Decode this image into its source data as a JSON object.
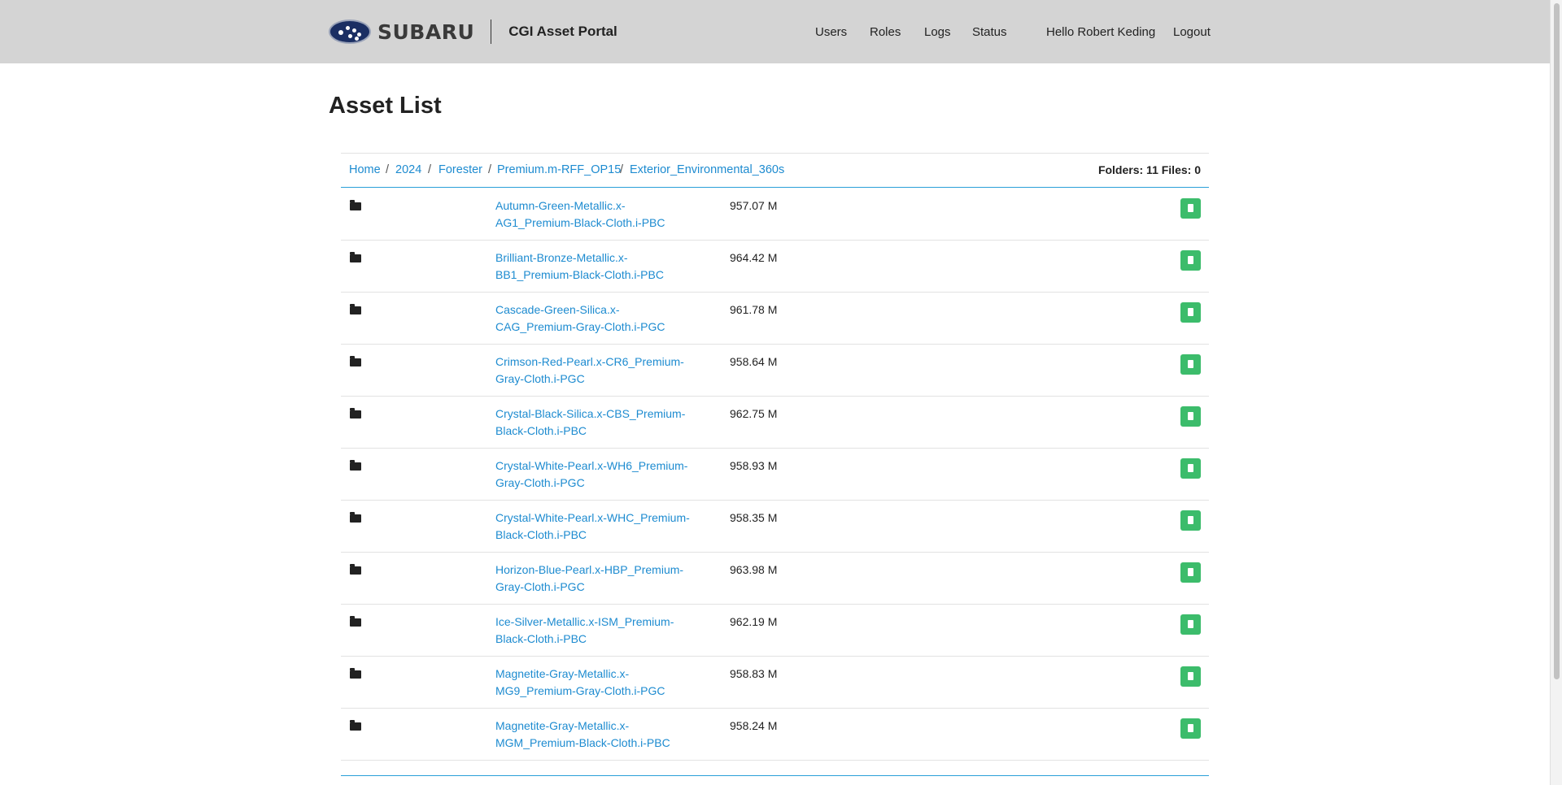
{
  "header": {
    "logo_text": "SUBARU",
    "portal_title": "CGI Asset Portal",
    "nav": [
      {
        "label": "Users"
      },
      {
        "label": "Roles"
      },
      {
        "label": "Logs"
      },
      {
        "label": "Status"
      }
    ],
    "greeting": "Hello Robert Keding",
    "logout": "Logout"
  },
  "page_title": "Asset List",
  "breadcrumb": {
    "items": [
      "Home",
      "2024",
      "Forester",
      "Premium.m-RFF_OP15",
      "Exterior_Environmental_360s"
    ],
    "separator": "/"
  },
  "counts": "Folders: 11 Files: 0",
  "rows": [
    {
      "name": "Autumn-Green-Metallic.x-AG1_Premium-Black-Cloth.i-PBC",
      "size": "957.07 M"
    },
    {
      "name": "Brilliant-Bronze-Metallic.x-BB1_Premium-Black-Cloth.i-PBC",
      "size": "964.42 M"
    },
    {
      "name": "Cascade-Green-Silica.x-CAG_Premium-Gray-Cloth.i-PGC",
      "size": "961.78 M"
    },
    {
      "name": "Crimson-Red-Pearl.x-CR6_Premium-Gray-Cloth.i-PGC",
      "size": "958.64 M"
    },
    {
      "name": "Crystal-Black-Silica.x-CBS_Premium-Black-Cloth.i-PBC",
      "size": "962.75 M"
    },
    {
      "name": "Crystal-White-Pearl.x-WH6_Premium-Gray-Cloth.i-PGC",
      "size": "958.93 M"
    },
    {
      "name": "Crystal-White-Pearl.x-WHC_Premium-Black-Cloth.i-PBC",
      "size": "958.35 M"
    },
    {
      "name": "Horizon-Blue-Pearl.x-HBP_Premium-Gray-Cloth.i-PGC",
      "size": "963.98 M"
    },
    {
      "name": "Ice-Silver-Metallic.x-ISM_Premium-Black-Cloth.i-PBC",
      "size": "962.19 M"
    },
    {
      "name": "Magnetite-Gray-Metallic.x-MG9_Premium-Gray-Cloth.i-PGC",
      "size": "958.83 M"
    },
    {
      "name": "Magnetite-Gray-Metallic.x-MGM_Premium-Black-Cloth.i-PBC",
      "size": "958.24 M"
    }
  ],
  "icons": {
    "logo": "subaru-logo-icon",
    "row_type": "folder-icon",
    "row_action": "file-icon"
  },
  "colors": {
    "link": "#1d8bd0",
    "header_bg": "#d4d4d4",
    "action_button": "#3cbc6b",
    "accent_border": "#2a9fd8"
  }
}
